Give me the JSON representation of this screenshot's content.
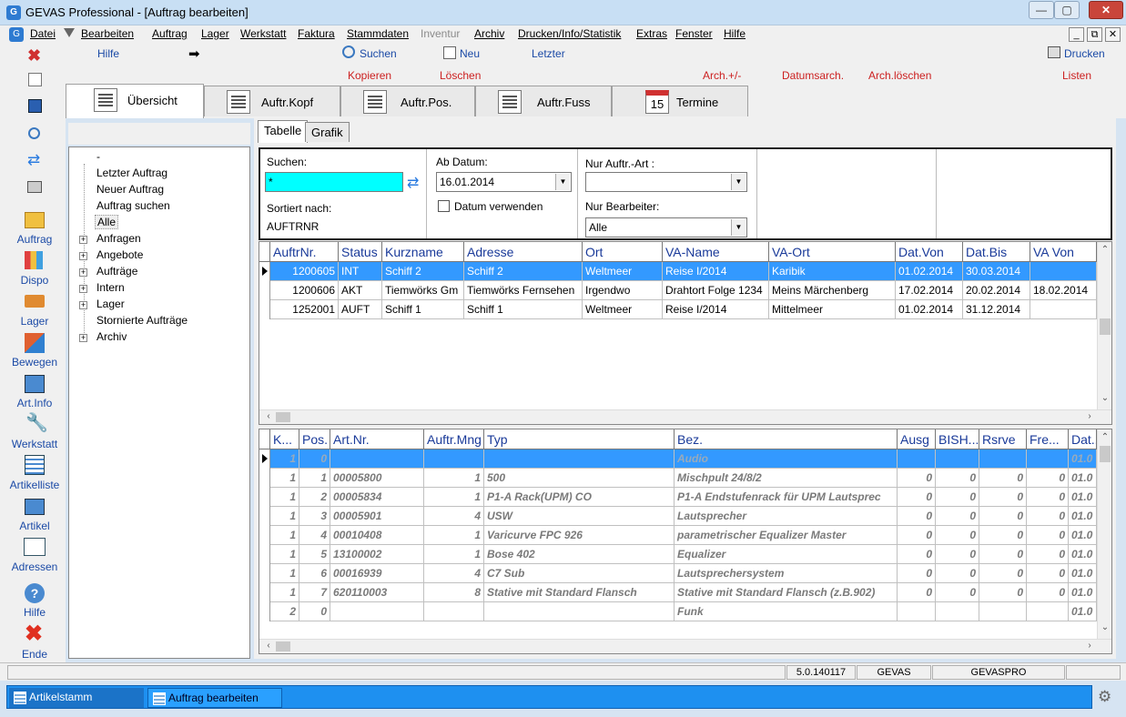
{
  "window": {
    "title": "GEVAS Professional - [Auftrag bearbeiten]",
    "min": "—",
    "max": "▢",
    "close": "✕"
  },
  "menu": [
    "Datei",
    "Bearbeiten",
    "Auftrag",
    "Lager",
    "Werkstatt",
    "Faktura",
    "Stammdaten",
    "Inventur",
    "Archiv",
    "Drucken/Info/Statistik",
    "Extras",
    "Fenster",
    "Hilfe"
  ],
  "menu_disabled": "Inventur",
  "mdi_buttons": [
    "_",
    "⧉",
    "✕"
  ],
  "toolbar": {
    "hilfe": "Hilfe",
    "suchen": "Suchen",
    "neu": "Neu",
    "letzter": "Letzter",
    "drucken": "Drucken",
    "kopieren": "Kopieren",
    "loeschen": "Löschen",
    "arch": "Arch.+/-",
    "datumsarch": "Datumsarch.",
    "archloeschen": "Arch.löschen",
    "listen": "Listen"
  },
  "sidebar": [
    "Auftrag",
    "Dispo",
    "Lager",
    "Bewegen",
    "Art.Info",
    "Werkstatt",
    "Artikelliste",
    "Artikel",
    "Adressen",
    "Hilfe",
    "Ende"
  ],
  "tabs": [
    "Übersicht",
    "Auftr.Kopf",
    "Auftr.Pos.",
    "Auftr.Fuss",
    "Termine"
  ],
  "termine_day": "15",
  "tree": {
    "items": [
      "-",
      "Letzter Auftrag",
      "Neuer Auftrag",
      "Auftrag suchen",
      "Alle"
    ],
    "expandable": [
      "Anfragen",
      "Angebote",
      "Aufträge",
      "Intern",
      "Lager"
    ],
    "storno": "Stornierte Aufträge",
    "archiv": "Archiv"
  },
  "subtabs": [
    "Tabelle",
    "Grafik"
  ],
  "filter": {
    "suchen_label": "Suchen:",
    "suchen_value": "*",
    "sortiert_label": "Sortiert nach:",
    "sortiert_value": "AUFTRNR",
    "ab_datum_label": "Ab Datum:",
    "ab_datum_value": "16.01.2014",
    "datum_verwenden": "Datum verwenden",
    "nur_art_label": "Nur Auftr.-Art :",
    "nur_art_value": "",
    "nur_bearbeiter_label": "Nur Bearbeiter:",
    "nur_bearbeiter_value": "Alle"
  },
  "orders": {
    "headers": [
      "AuftrNr.",
      "Status",
      "Kurzname",
      "Adresse",
      "Ort",
      "VA-Name",
      "VA-Ort",
      "Dat.Von",
      "Dat.Bis",
      "VA Von"
    ],
    "rows": [
      [
        "1200605",
        "INT",
        "Schiff 2",
        "Schiff 2",
        "Weltmeer",
        "Reise I/2014",
        "Karibik",
        "01.02.2014",
        "30.03.2014",
        ""
      ],
      [
        "1200606",
        "AKT",
        "Tiemwörks Gm",
        "Tiemwörks Fernsehen",
        "Irgendwo",
        "Drahtort Folge 1234",
        "Meins Märchenberg",
        "17.02.2014",
        "20.02.2014",
        "18.02.2014"
      ],
      [
        "1252001",
        "AUFT",
        "Schiff 1",
        "Schiff 1",
        "Weltmeer",
        "Reise I/2014",
        "Mittelmeer",
        "01.02.2014",
        "31.12.2014",
        ""
      ]
    ]
  },
  "positions": {
    "headers": [
      "K...",
      "Pos.",
      "Art.Nr.",
      "Auftr.Mng",
      "Typ",
      "Bez.",
      "Ausg",
      "BISH...",
      "Rsrve",
      "Fre...",
      "Dat..."
    ],
    "rows": [
      [
        "1",
        "0",
        "",
        "",
        "",
        "Audio",
        "",
        "",
        "",
        "",
        "01.0"
      ],
      [
        "1",
        "1",
        "00005800",
        "1",
        "500",
        "Mischpult 24/8/2",
        "0",
        "0",
        "0",
        "0",
        "01.0"
      ],
      [
        "1",
        "2",
        "00005834",
        "1",
        "P1-A Rack(UPM) CO",
        "P1-A Endstufenrack für UPM Lautsprec",
        "0",
        "0",
        "0",
        "0",
        "01.0"
      ],
      [
        "1",
        "3",
        "00005901",
        "4",
        "USW",
        "Lautsprecher",
        "0",
        "0",
        "0",
        "0",
        "01.0"
      ],
      [
        "1",
        "4",
        "00010408",
        "1",
        "Varicurve FPC 926",
        "parametrischer Equalizer Master",
        "0",
        "0",
        "0",
        "0",
        "01.0"
      ],
      [
        "1",
        "5",
        "13100002",
        "1",
        "Bose 402",
        " Equalizer",
        "0",
        "0",
        "0",
        "0",
        "01.0"
      ],
      [
        "1",
        "6",
        "00016939",
        "4",
        "C7 Sub",
        "Lautsprechersystem",
        "0",
        "0",
        "0",
        "0",
        "01.0"
      ],
      [
        "1",
        "7",
        "620110003",
        "8",
        "Stative mit Standard Flansch",
        "Stative mit Standard Flansch (z.B.902)",
        "0",
        "0",
        "0",
        "0",
        "01.0"
      ],
      [
        "2",
        "0",
        "",
        "",
        "",
        "Funk",
        "",
        "",
        "",
        "",
        "01.0"
      ]
    ]
  },
  "status": {
    "version": "5.0.140117",
    "company": "GEVAS",
    "db": "GEVASPRO"
  },
  "taskbar": [
    "Artikelstamm",
    "Auftrag bearbeiten"
  ]
}
